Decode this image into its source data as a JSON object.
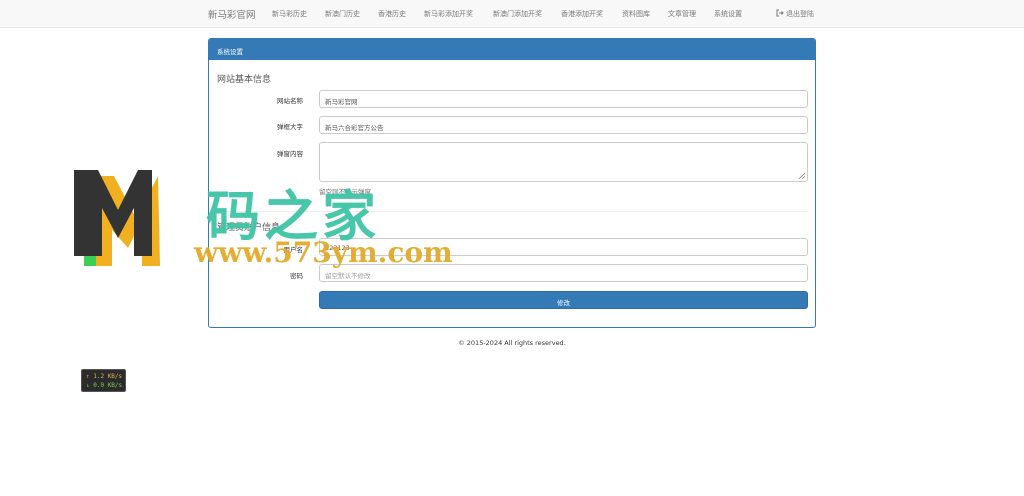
{
  "navbar": {
    "brand": "新马彩官网",
    "items": [
      "新马彩历史",
      "新澳门历史",
      "香港历史",
      "新马彩添加开奖",
      "新澳门添加开奖",
      "香港添加开奖",
      "资料图库",
      "文章管理",
      "系统设置"
    ],
    "logout_label": "退出登陆",
    "logout_icon": "sign-out-icon"
  },
  "panel": {
    "heading": "系统设置",
    "site_section": {
      "title": "网站基本信息",
      "site_name_label": "网站名称",
      "site_name_value": "新马彩官网",
      "popup_title_label": "弹框大字",
      "popup_title_value": "新马六合彩官方公告",
      "popup_content_label": "弹窗内容",
      "popup_content_value": "",
      "help_text": "留空则不显示弹窗"
    },
    "admin_section": {
      "title": "管理员账户信息",
      "username_label": "用户名",
      "username_value": "123123",
      "password_label": "密码",
      "password_placeholder": "留空默认不修改"
    },
    "submit_label": "修改"
  },
  "footer": {
    "copyright": "© 2015-2024 All rights reserved."
  },
  "netspeed": {
    "upload": "↑ 1.2 KB/s",
    "download": "↓ 0.0 KB/s"
  },
  "watermark": {
    "logo_letter": "M",
    "chinese_text": "码之家",
    "url_text": "www.573ym.com"
  },
  "colors": {
    "primary": "#337ab7",
    "navbar_bg": "#f8f8f8",
    "watermark_green": "#3fc4a6",
    "watermark_orange": "#e3a92a"
  }
}
